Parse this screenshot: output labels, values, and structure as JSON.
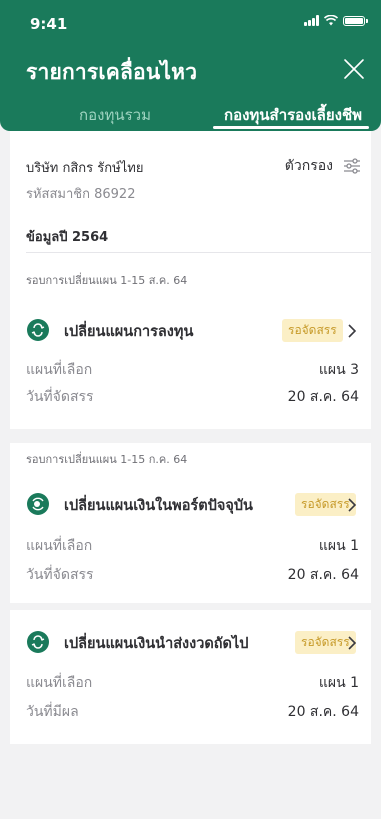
{
  "status_bar": {
    "time": "9:41"
  },
  "header": {
    "title": "รายการเคลื่อนไหว",
    "tabs": [
      {
        "label": "กองทุนรวม",
        "active": false
      },
      {
        "label": "กองทุนสำรองเลี้ยงชีพ",
        "active": true
      }
    ]
  },
  "member": {
    "company": "บริษัท กสิกร รักษ์ไทย",
    "member_no": "รหัสสมาชิก 86922",
    "filter_label": "ตัวกรอง",
    "year_label": "ข้อมูลปี 2564"
  },
  "sections": [
    {
      "heading": "รอบการเปลี่ยนแผน 1-15 ส.ค. 64",
      "items": [
        {
          "title": "เปลี่ยนแผนการลงทุน",
          "badge": "รอจัดสรร",
          "rows": [
            {
              "label": "แผนที่เลือก",
              "value": "แผน 3"
            },
            {
              "label": "วันที่จัดสรร",
              "value": "20 ส.ค. 64"
            }
          ]
        }
      ]
    },
    {
      "heading": "รอบการเปลี่ยนแผน 1-15 ก.ค. 64",
      "items": [
        {
          "title": "เปลี่ยนแผนเงินในพอร์ตปัจจุบัน",
          "badge": "รอจัดสรร",
          "rows": [
            {
              "label": "แผนที่เลือก",
              "value": "แผน 1"
            },
            {
              "label": "วันที่จัดสรร",
              "value": "20 ส.ค. 64"
            }
          ]
        },
        {
          "title": "เปลี่ยนแผนเงินนำส่งงวดถัดไป",
          "badge": "รอจัดสรร",
          "rows": [
            {
              "label": "แผนที่เลือก",
              "value": "แผน 1"
            },
            {
              "label": "วันที่มีผล",
              "value": "20 ส.ค. 64"
            }
          ]
        }
      ]
    }
  ],
  "colors": {
    "header_green": "#1a7a5b",
    "badge_bg": "#fbefc6",
    "badge_text": "#c79b2b",
    "page_bg": "#f2f2f3"
  }
}
